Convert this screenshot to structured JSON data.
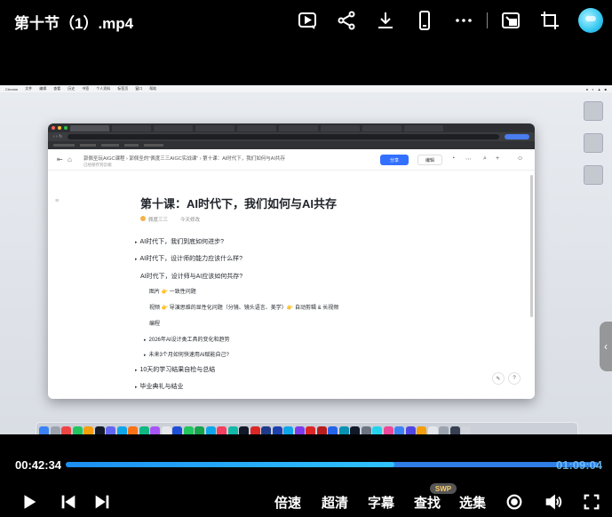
{
  "player": {
    "title": "第十节（1）.mp4",
    "current_time": "00:42:34",
    "total_time": "01:09:04",
    "progress": 0.616,
    "controls": {
      "speed_label": "倍速",
      "quality_label": "超清",
      "subtitle_label": "字幕",
      "search_label": "查找",
      "search_badge": "SWP",
      "episodes_label": "选集"
    }
  },
  "top_icons": [
    "play-list-icon",
    "share-icon",
    "download-icon",
    "phone-icon",
    "more-icon",
    "picture-in-picture-icon",
    "crop-icon",
    "avatar"
  ],
  "video_frame": {
    "browser": {
      "breadcrumb": "郭佩圣玩AIGC课程 › 郭佩圣的\"佩度三三AIGC实战课\" › 第十课：AI时代下，我们如何与AI共存",
      "breadcrumb_sub": "已经保存到云端",
      "share_label": "分享",
      "edit_label": "编辑",
      "doc": {
        "title": "第十课：AI时代下，我们如何与AI共存",
        "author": "佩度三三",
        "updated": "今天修改",
        "outline": [
          {
            "text": "AI时代下，我们到底如何进步?",
            "level": 1
          },
          {
            "text": "AI时代下，设计师的能力应该什么样?",
            "level": 1
          },
          {
            "text": "AI时代下，设计师与AI应该如何共存?",
            "level": 1
          },
          {
            "text": "图片 👉 一致性问题",
            "level": 2
          },
          {
            "text": "视频 👉 导演思维的显性化问题（分镜、镜头语言、美学）👉 自动剪辑 & 长视频",
            "level": 2
          },
          {
            "text": "编程",
            "level": 2
          },
          {
            "text": "2026年AI设计类工具的变化和趋势",
            "level": 2
          },
          {
            "text": "未来3个月如何快速用AI赋能自己?",
            "level": 2
          },
          {
            "text": "10天的学习结果自检与总结",
            "level": 1
          },
          {
            "text": "毕业典礼与结业",
            "level": 1
          }
        ]
      }
    }
  }
}
